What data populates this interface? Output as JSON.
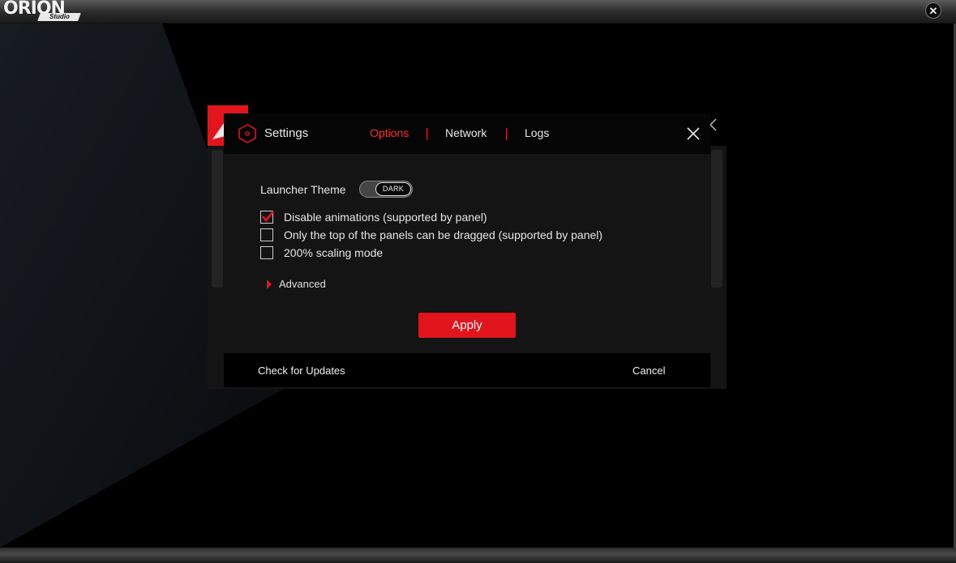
{
  "app": {
    "logo_text": "ORION",
    "logo_subtext": "Studio",
    "close_glyph": "✕"
  },
  "dialog": {
    "title": "Settings",
    "icon": "hexagon-icon",
    "tabs": [
      {
        "label": "Options",
        "active": true
      },
      {
        "label": "Network",
        "active": false
      },
      {
        "label": "Logs",
        "active": false
      }
    ],
    "theme": {
      "label": "Launcher Theme",
      "value": "DARK"
    },
    "options": [
      {
        "label": "Disable animations (supported by panel)",
        "checked": true
      },
      {
        "label": "Only the top of the panels can be dragged (supported by panel)",
        "checked": false
      },
      {
        "label": "200% scaling mode",
        "checked": false
      }
    ],
    "advanced_label": "Advanced",
    "apply_label": "Apply",
    "check_updates_label": "Check for Updates",
    "cancel_label": "Cancel"
  },
  "colors": {
    "accent": "#e3151c",
    "active_tab": "#ff2a2a",
    "dialog_body": "#141414",
    "background": "#000000"
  }
}
